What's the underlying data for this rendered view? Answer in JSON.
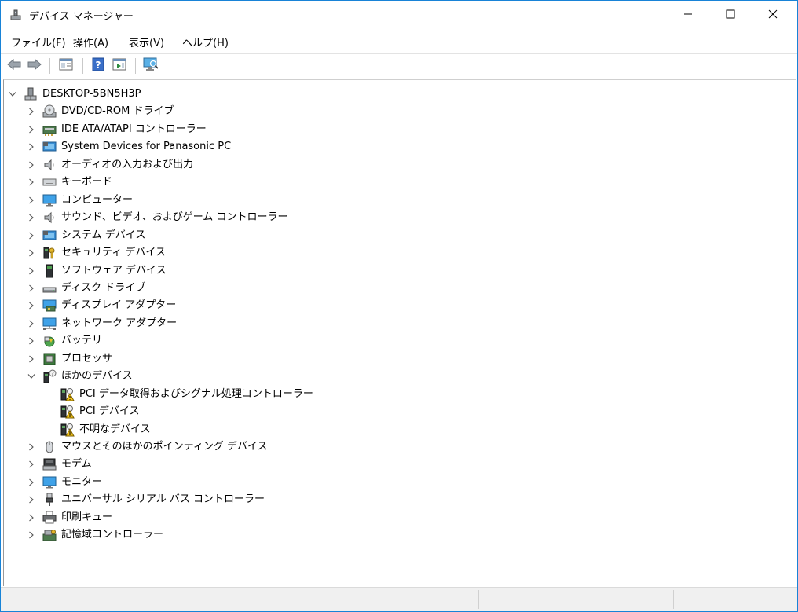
{
  "window": {
    "title": "デバイス マネージャー",
    "controls": {
      "minimize": "minimize-icon",
      "maximize": "maximize-icon",
      "close": "close-icon"
    }
  },
  "menu": [
    {
      "label": "ファイル(F)"
    },
    {
      "label": "操作(A)"
    },
    {
      "label": "表示(V)"
    },
    {
      "label": "ヘルプ(H)"
    }
  ],
  "toolbar": {
    "buttons": [
      "back-arrow-icon",
      "forward-arrow-icon",
      "properties-pane-icon",
      "help-icon",
      "action-pane-icon",
      "scan-hardware-monitor-icon"
    ]
  },
  "tree": {
    "root": {
      "label": "DESKTOP-5BN5H3P",
      "expanded": true,
      "icon": "computer-tower-icon"
    },
    "categories": [
      {
        "label": "DVD/CD-ROM ドライブ",
        "icon": "dvd-drive-icon",
        "expanded": false
      },
      {
        "label": "IDE ATA/ATAPI コントローラー",
        "icon": "ide-controller-icon",
        "expanded": false
      },
      {
        "label": "System Devices for Panasonic PC",
        "icon": "system-device-icon",
        "expanded": false
      },
      {
        "label": "オーディオの入力および出力",
        "icon": "speaker-icon",
        "expanded": false
      },
      {
        "label": "キーボード",
        "icon": "keyboard-icon",
        "expanded": false
      },
      {
        "label": "コンピューター",
        "icon": "monitor-icon",
        "expanded": false
      },
      {
        "label": "サウンド、ビデオ、およびゲーム コントローラー",
        "icon": "speaker-icon",
        "expanded": false
      },
      {
        "label": "システム デバイス",
        "icon": "system-device-icon",
        "expanded": false
      },
      {
        "label": "セキュリティ デバイス",
        "icon": "security-key-icon",
        "expanded": false
      },
      {
        "label": "ソフトウェア デバイス",
        "icon": "software-device-icon",
        "expanded": false
      },
      {
        "label": "ディスク ドライブ",
        "icon": "disk-drive-icon",
        "expanded": false
      },
      {
        "label": "ディスプレイ アダプター",
        "icon": "display-adapter-icon",
        "expanded": false
      },
      {
        "label": "ネットワーク アダプター",
        "icon": "network-adapter-icon",
        "expanded": false
      },
      {
        "label": "バッテリ",
        "icon": "battery-icon",
        "expanded": false
      },
      {
        "label": "プロセッサ",
        "icon": "processor-icon",
        "expanded": false
      },
      {
        "label": "ほかのデバイス",
        "icon": "unknown-device-icon",
        "expanded": true,
        "children": [
          {
            "label": "PCI データ取得およびシグナル処理コントローラー",
            "icon": "warning-device-icon"
          },
          {
            "label": "PCI デバイス",
            "icon": "warning-device-icon"
          },
          {
            "label": "不明なデバイス",
            "icon": "warning-device-icon"
          }
        ]
      },
      {
        "label": "マウスとそのほかのポインティング デバイス",
        "icon": "mouse-icon",
        "expanded": false
      },
      {
        "label": "モデム",
        "icon": "modem-icon",
        "expanded": false
      },
      {
        "label": "モニター",
        "icon": "monitor-icon",
        "expanded": false
      },
      {
        "label": "ユニバーサル シリアル バス コントローラー",
        "icon": "usb-icon",
        "expanded": false
      },
      {
        "label": "印刷キュー",
        "icon": "printer-icon",
        "expanded": false
      },
      {
        "label": "記憶域コントローラー",
        "icon": "storage-controller-icon",
        "expanded": false
      }
    ]
  },
  "statusbar": {
    "segments": [
      "",
      "",
      ""
    ]
  }
}
